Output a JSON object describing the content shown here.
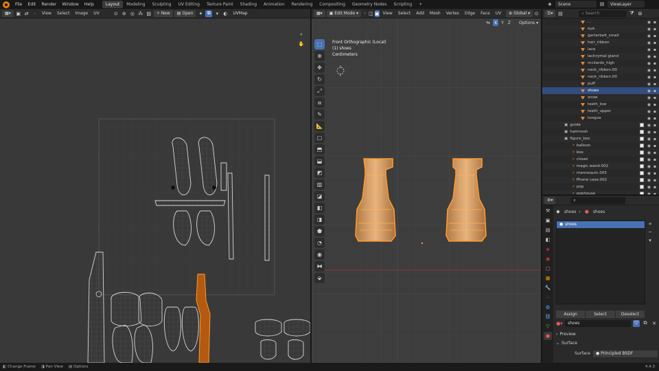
{
  "app": {
    "menus": [
      "File",
      "Edit",
      "Render",
      "Window",
      "Help"
    ],
    "workspaces": [
      "Layout",
      "Modeling",
      "Sculpting",
      "UV Editing",
      "Texture Paint",
      "Shading",
      "Animation",
      "Rendering",
      "Compositing",
      "Geometry Nodes",
      "Scripting"
    ],
    "active_workspace": "Layout",
    "add_workspace": "+",
    "scene": "Scene",
    "view_layer": "ViewLayer",
    "version": "4.4.3"
  },
  "uv_editor": {
    "menu": [
      "View",
      "Select",
      "Image",
      "UV"
    ],
    "new_label": "New",
    "open_label": "Open",
    "uvmap": "UVMap"
  },
  "viewport": {
    "mode": "Edit Mode",
    "menu": [
      "View",
      "Select",
      "Add",
      "Mesh",
      "Vertex",
      "Edge",
      "Face",
      "UV"
    ],
    "orientation": "Global",
    "options_label": "Options",
    "axes": [
      "X",
      "Y",
      "Z"
    ],
    "overlay_lines": [
      "Front Orthographic (Local)",
      "(1) shoes",
      "Centimeters"
    ]
  },
  "outliner": {
    "search_placeholder": "Search",
    "items": [
      {
        "label": "...",
        "type": "tri"
      },
      {
        "label": "eye",
        "type": "tri"
      },
      {
        "label": "garterbelt_small",
        "type": "tri"
      },
      {
        "label": "hair_ribbon",
        "type": "tri"
      },
      {
        "label": "lace",
        "type": "tri"
      },
      {
        "label": "lachrymal gland",
        "type": "tri"
      },
      {
        "label": "mcilardo_high",
        "type": "tri"
      },
      {
        "label": "neck_ribbon.00",
        "type": "tri"
      },
      {
        "label": "neck_ribbon.00",
        "type": "tri"
      },
      {
        "label": "puff",
        "type": "tri"
      },
      {
        "label": "shoes",
        "type": "tri",
        "selected": true
      },
      {
        "label": "snow",
        "type": "tri"
      },
      {
        "label": "teeth_low",
        "type": "tri"
      },
      {
        "label": "teeth_upper",
        "type": "tri"
      },
      {
        "label": "tongue",
        "type": "tri"
      },
      {
        "label": "guide",
        "type": "coll"
      },
      {
        "label": "hairmesh",
        "type": "coll"
      },
      {
        "label": "figure_box",
        "type": "coll"
      },
      {
        "label": "balloon",
        "type": "obj"
      },
      {
        "label": "box",
        "type": "obj"
      },
      {
        "label": "closet",
        "type": "obj"
      },
      {
        "label": "magic wand.002",
        "type": "obj"
      },
      {
        "label": "mannequin.005",
        "type": "obj"
      },
      {
        "label": "Phone case.002",
        "type": "obj"
      },
      {
        "label": "pop",
        "type": "obj"
      },
      {
        "label": "pophouse",
        "type": "obj"
      }
    ]
  },
  "properties": {
    "breadcrumb_object": "shoes",
    "breadcrumb_data": "shoes",
    "material_slot": "shoes",
    "assign_label": "Assign",
    "select_label": "Select",
    "deselect_label": "Deselect",
    "material_name": "shoes",
    "preview_label": "Preview",
    "surface_label": "Surface",
    "surface_field_label": "Surface",
    "surface_value": "Principled BSDF"
  },
  "statusbar": {
    "items": [
      "Change Frame",
      "Pan View",
      "Options"
    ]
  },
  "colors": {
    "accent": "#4772b3",
    "selection": "#e87d0d",
    "object_tri": "#e08a3c"
  }
}
